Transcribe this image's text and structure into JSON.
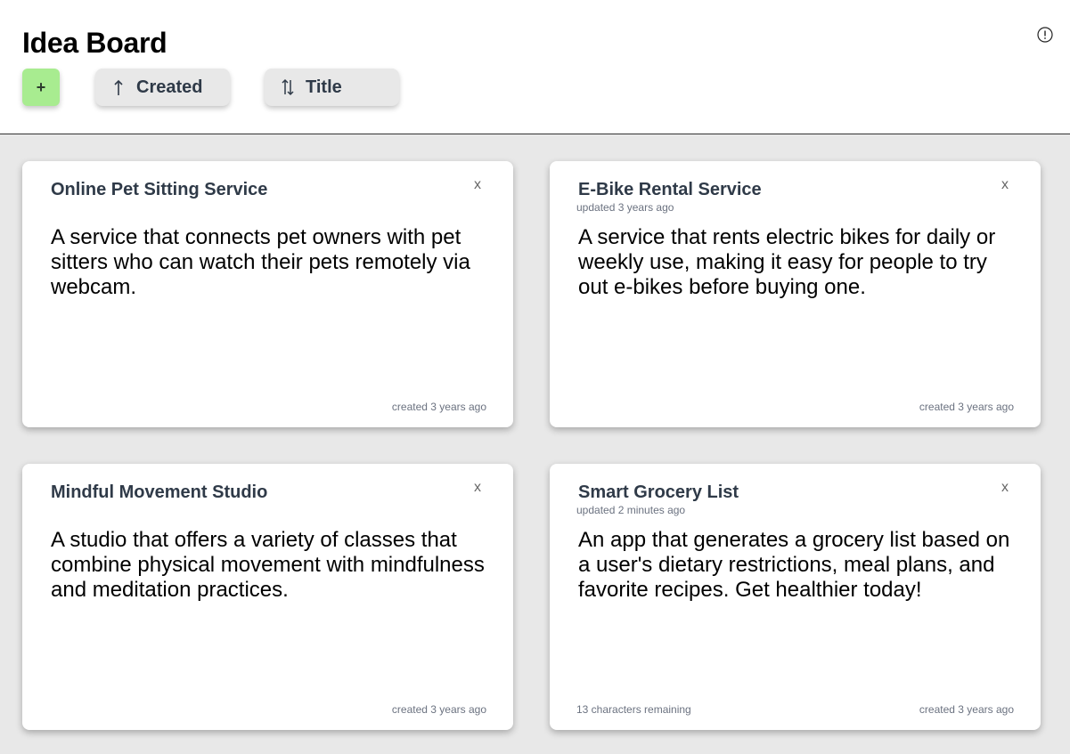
{
  "header": {
    "title": "Idea Board",
    "add_label": "+",
    "sort_created": {
      "label": "Created",
      "icon": "arrow-up-icon"
    },
    "sort_title": {
      "label": "Title",
      "icon": "sort-arrows-icon"
    },
    "info_icon": "info-circle-icon"
  },
  "colors": {
    "add_button": "#a8ec90",
    "sort_button": "#e8e8e8",
    "board_background": "#e8e8e8",
    "card_title": "#2f3a48"
  },
  "cards": [
    {
      "title": "Online Pet Sitting Service",
      "updated": "",
      "close": "x",
      "body": "A service that connects pet owners with pet sitters who can watch their pets remotely via webcam.",
      "created": "created 3 years ago",
      "remaining": ""
    },
    {
      "title": "E-Bike Rental Service",
      "updated": "updated 3 years ago",
      "close": "x",
      "body": "A service that rents electric bikes for daily or weekly use, making it easy for people to try out e-bikes before buying one.",
      "created": "created 3 years ago",
      "remaining": ""
    },
    {
      "title": "Mindful Movement Studio",
      "updated": "",
      "close": "x",
      "body": "A studio that offers a variety of classes that combine physical movement with mindfulness and meditation practices.",
      "created": "created 3 years ago",
      "remaining": ""
    },
    {
      "title": "Smart Grocery List",
      "updated": "updated 2 minutes ago",
      "close": "x",
      "body": "An app that generates a grocery list based on a user's dietary restrictions, meal plans, and favorite recipes. Get healthier today!",
      "created": "created 3 years ago",
      "remaining": "13 characters remaining"
    }
  ]
}
